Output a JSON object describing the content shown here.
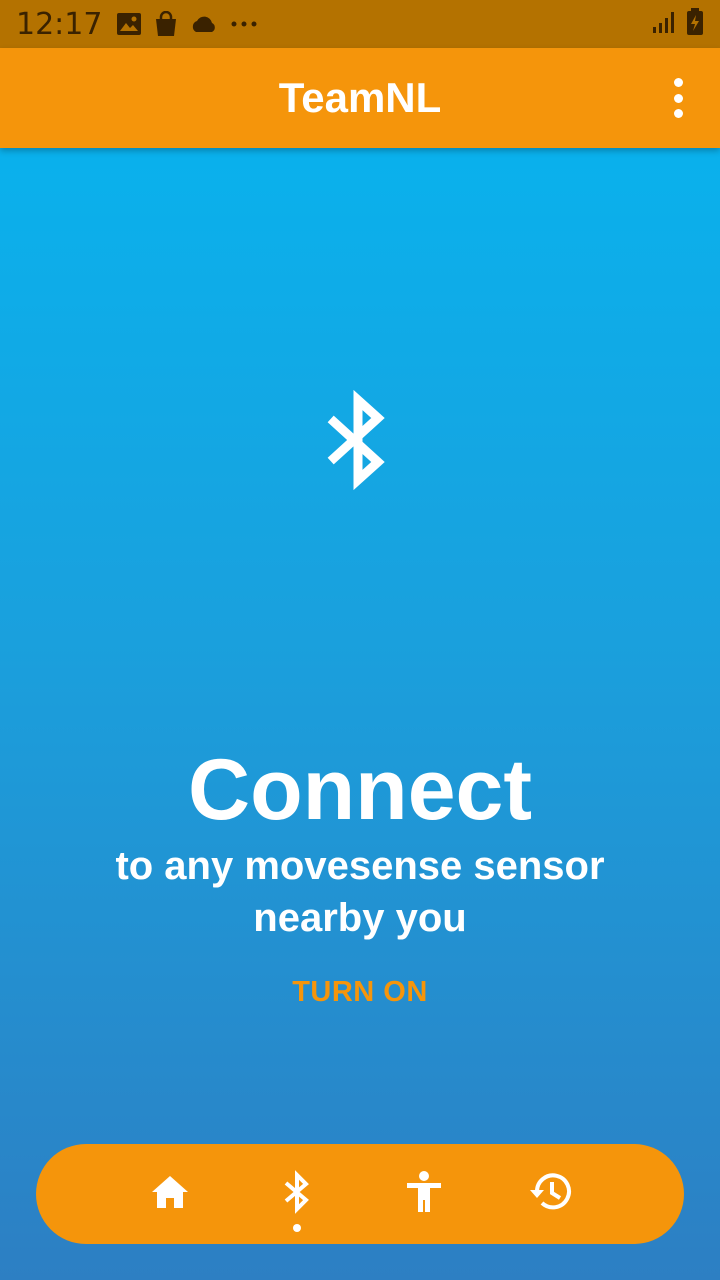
{
  "status_bar": {
    "time": "12:17",
    "icons": [
      "image-icon",
      "shopping-bag-icon",
      "cloud-icon",
      "more-dots-icon",
      "signal-icon",
      "battery-charging-icon"
    ]
  },
  "app_bar": {
    "title": "TeamNL",
    "menu_icon": "more-vert-icon"
  },
  "main": {
    "hero_icon": "bluetooth-icon",
    "headline": "Connect",
    "subtitle": "to any movesense sensor nearby you",
    "action_label": "TURN ON"
  },
  "bottom_nav": {
    "items": [
      {
        "icon": "home-icon",
        "selected": false
      },
      {
        "icon": "bluetooth-icon",
        "selected": true
      },
      {
        "icon": "accessibility-icon",
        "selected": false
      },
      {
        "icon": "history-icon",
        "selected": false
      }
    ]
  },
  "colors": {
    "accent": "#f5950b",
    "status_bar": "#b47200",
    "gradient_top": "#05b6f1",
    "gradient_bottom": "#2d7fc3",
    "text": "#ffffff"
  }
}
